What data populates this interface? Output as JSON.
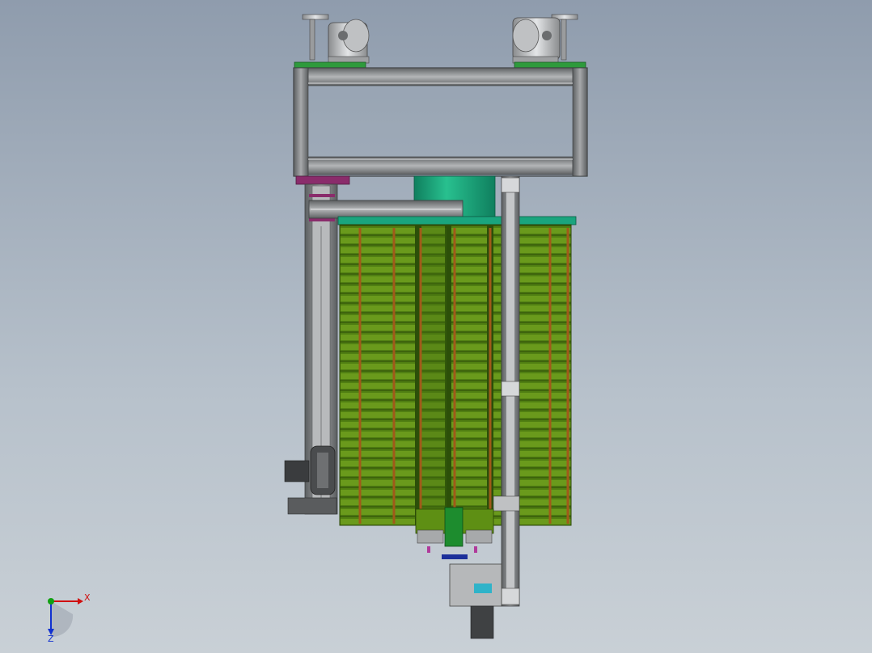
{
  "viewport": {
    "background_top": "#8f9cad",
    "background_bottom": "#c9d0d6"
  },
  "colors": {
    "frame_gray": "#7d7f80",
    "frame_light": "#b9bbbd",
    "plate_green": "#2e9a3c",
    "teal": "#1aa57e",
    "magenta": "#8a2c6b",
    "slot_green": "#4f8f1b",
    "rod_orange": "#a05a1a",
    "axis_x": "#d01010",
    "axis_y": "#10a010",
    "axis_z": "#1030d0"
  },
  "triad": {
    "x_label": "X",
    "z_label": "Z"
  }
}
